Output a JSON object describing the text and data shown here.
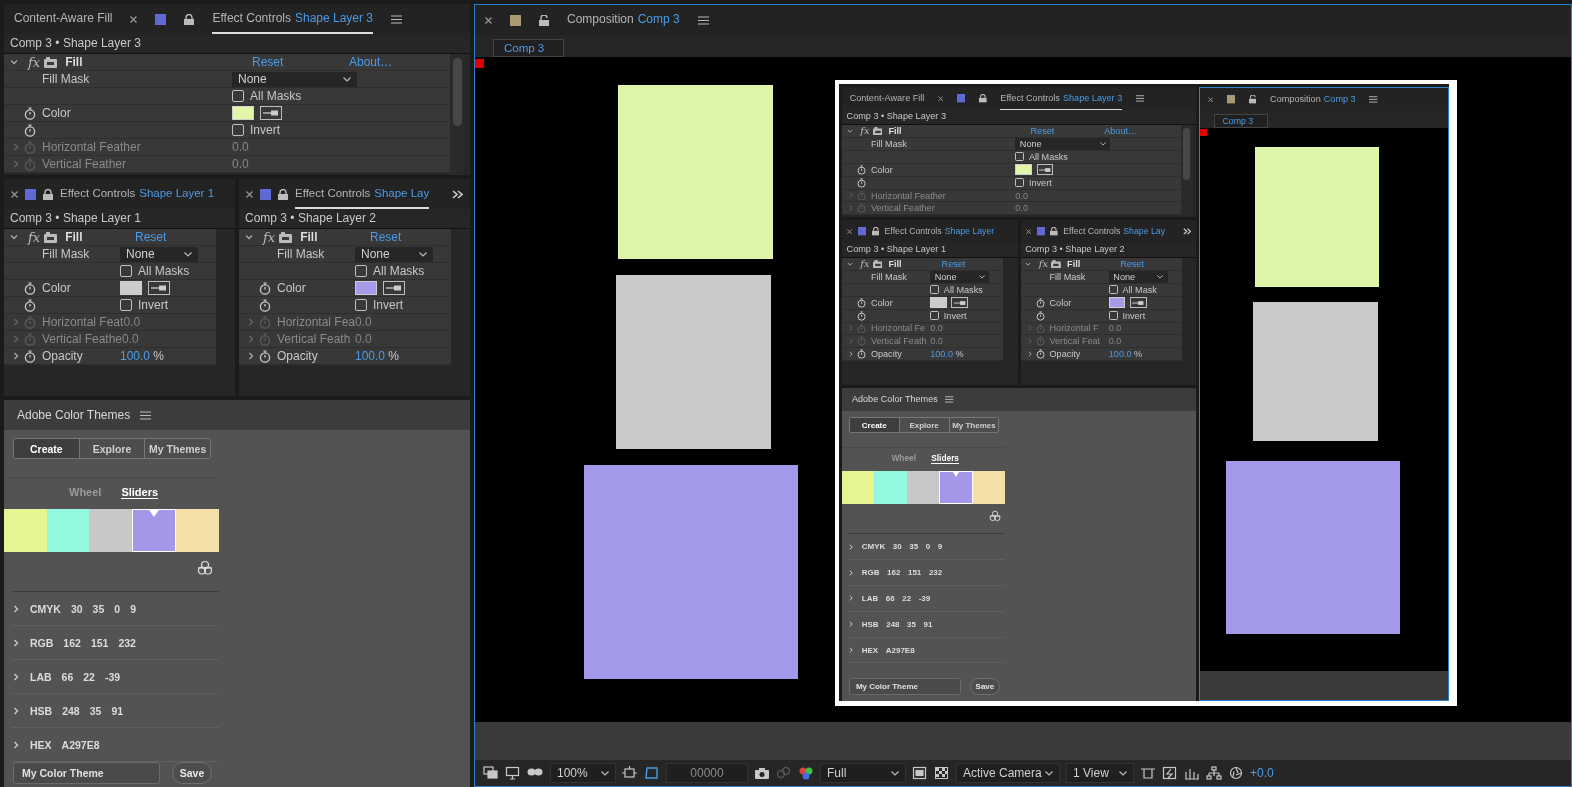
{
  "workspace": {
    "effect_panels": [
      {
        "tabs": [
          {
            "kind": "plain",
            "label": "Content-Aware Fill",
            "selected": false
          },
          {
            "kind": "effect",
            "label": "Effect Controls",
            "layer": "Shape Layer 3",
            "selected": true
          }
        ],
        "breadcrumb": "Comp 3 • Shape Layer 3",
        "effect": {
          "badge": "fx",
          "name": "Fill",
          "reset": "Reset",
          "about": "About…",
          "rows": [
            {
              "kind": "dropdown",
              "label": "Fill Mask",
              "value": "None",
              "stopwatch": false
            },
            {
              "kind": "checkbox",
              "label": "All Masks",
              "checked": false,
              "stopwatch": false
            },
            {
              "kind": "color",
              "label": "Color",
              "color": "#e1f6a6",
              "stopwatch": true
            },
            {
              "kind": "checkbox",
              "label": "Invert",
              "checked": false,
              "stopwatch": true
            },
            {
              "kind": "number",
              "label": "Horizontal Feather",
              "value": "0.0",
              "disabled": true,
              "stopwatch": true
            },
            {
              "kind": "number",
              "label": "Vertical Feather",
              "value": "0.0",
              "disabled": true,
              "stopwatch": true
            }
          ]
        }
      },
      {
        "tabs": [
          {
            "kind": "effect",
            "label": "Effect Controls",
            "layer": "Shape Layer 1",
            "selected": false
          }
        ],
        "breadcrumb": "Comp 3 • Shape Layer 1",
        "effect": {
          "badge": "fx",
          "name": "Fill",
          "reset": "Reset",
          "rows": [
            {
              "kind": "dropdown",
              "label": "Fill Mask",
              "value": "None",
              "stopwatch": false
            },
            {
              "kind": "checkbox",
              "label": "All Masks",
              "checked": false,
              "stopwatch": false
            },
            {
              "kind": "color",
              "label": "Color",
              "color": "#cbcbcb",
              "stopwatch": true
            },
            {
              "kind": "checkbox",
              "label": "Invert",
              "checked": false,
              "stopwatch": true
            },
            {
              "kind": "number",
              "label": "Horizontal Feat",
              "value": "0.0",
              "disabled": true,
              "stopwatch": true
            },
            {
              "kind": "number",
              "label": "Vertical Feathe",
              "value": "0.0",
              "disabled": true,
              "stopwatch": true
            },
            {
              "kind": "number",
              "label": "Opacity",
              "value": "100.0",
              "unit": "%",
              "disabled": false,
              "stopwatch": true
            }
          ]
        }
      },
      {
        "tabs": [
          {
            "kind": "effect",
            "label": "Effect Controls",
            "layer": "Shape Lay",
            "selected": true
          }
        ],
        "breadcrumb": "Comp 3 • Shape Layer 2",
        "effect": {
          "badge": "fx",
          "name": "Fill",
          "reset": "Reset",
          "rows": [
            {
              "kind": "dropdown",
              "label": "Fill Mask",
              "value": "None",
              "stopwatch": false
            },
            {
              "kind": "checkbox",
              "label": "All Masks",
              "checked": false,
              "stopwatch": false
            },
            {
              "kind": "color",
              "label": "Color",
              "color": "#a59bea",
              "stopwatch": true
            },
            {
              "kind": "checkbox",
              "label": "Invert",
              "checked": false,
              "stopwatch": true
            },
            {
              "kind": "number",
              "label": "Horizontal Fea",
              "value": "0.0",
              "disabled": true,
              "stopwatch": true
            },
            {
              "kind": "number",
              "label": "Vertical Feath",
              "value": "0.0",
              "disabled": true,
              "stopwatch": true
            },
            {
              "kind": "number",
              "label": "Opacity",
              "value": "100.0",
              "unit": "%",
              "disabled": false,
              "stopwatch": true
            }
          ]
        }
      }
    ],
    "color_themes": {
      "title": "Adobe Color Themes",
      "tabs": [
        {
          "label": "Create",
          "selected": true
        },
        {
          "label": "Explore",
          "selected": false
        },
        {
          "label": "My Themes",
          "selected": false
        }
      ],
      "modes": [
        {
          "label": "Wheel",
          "selected": false
        },
        {
          "label": "Sliders",
          "selected": true
        }
      ],
      "swatches": [
        {
          "color": "#e6f593",
          "selected": false
        },
        {
          "color": "#94f8e0",
          "selected": false
        },
        {
          "color": "#c8c8c8",
          "selected": false
        },
        {
          "color": "#a297e8",
          "selected": true
        },
        {
          "color": "#f5dfa8",
          "selected": false
        }
      ],
      "models": [
        {
          "name": "CMYK",
          "values": [
            "30",
            "35",
            "0",
            "9"
          ]
        },
        {
          "name": "RGB",
          "values": [
            "162",
            "151",
            "232"
          ]
        },
        {
          "name": "LAB",
          "values": [
            "66",
            "22",
            "-39"
          ]
        },
        {
          "name": "HSB",
          "values": [
            "248",
            "35",
            "91"
          ]
        },
        {
          "name": "HEX",
          "values": [
            "A297E8"
          ]
        }
      ],
      "theme_name": "My Color Theme",
      "save": "Save"
    },
    "composition": {
      "title": "Composition",
      "name": "Comp 3",
      "viewer_tabs": [
        {
          "label": "Comp 3",
          "selected": true
        }
      ],
      "viewer": {
        "layers": [
          {
            "kind": "shape",
            "color": "#ddf5a9"
          },
          {
            "kind": "shape",
            "color": "#c9c9c9"
          },
          {
            "kind": "shape",
            "color": "#a299e8"
          },
          {
            "kind": "screenshot",
            "workspace": {
              "effect_panels": [
                {
                  "tabs": [
                    {
                      "kind": "plain",
                      "label": "Content-Aware Fill",
                      "selected": false
                    },
                    {
                      "kind": "effect",
                      "label": "Effect Controls",
                      "layer": "Shape Layer 3",
                      "selected": true
                    }
                  ],
                  "breadcrumb": "Comp 3 • Shape Layer 3",
                  "effect": {
                    "badge": "fx",
                    "name": "Fill",
                    "reset": "Reset",
                    "about": "About…",
                    "rows": [
                      {
                        "kind": "dropdown",
                        "label": "Fill Mask",
                        "value": "None",
                        "stopwatch": false
                      },
                      {
                        "kind": "checkbox",
                        "label": "All Masks",
                        "checked": false,
                        "stopwatch": false
                      },
                      {
                        "kind": "color",
                        "label": "Color",
                        "color": "#e1f6a6",
                        "stopwatch": true
                      },
                      {
                        "kind": "checkbox",
                        "label": "Invert",
                        "checked": false,
                        "stopwatch": true
                      },
                      {
                        "kind": "number",
                        "label": "Horizontal Feather",
                        "value": "0.0",
                        "disabled": true,
                        "stopwatch": true
                      },
                      {
                        "kind": "number",
                        "label": "Vertical Feather",
                        "value": "0.0",
                        "disabled": true,
                        "stopwatch": true
                      }
                    ]
                  }
                },
                {
                  "tabs": [
                    {
                      "kind": "effect",
                      "label": "Effect Controls",
                      "layer": "Shape Layer",
                      "selected": false
                    }
                  ],
                  "breadcrumb": "Comp 3 • Shape Layer 1",
                  "effect": {
                    "badge": "fx",
                    "name": "Fill",
                    "reset": "Reset",
                    "rows": [
                      {
                        "kind": "dropdown",
                        "label": "Fill Mask",
                        "value": "None",
                        "stopwatch": false
                      },
                      {
                        "kind": "checkbox",
                        "label": "All Masks",
                        "checked": false,
                        "stopwatch": false
                      },
                      {
                        "kind": "color",
                        "label": "Color",
                        "color": "#cbcbcb",
                        "stopwatch": true
                      },
                      {
                        "kind": "checkbox",
                        "label": "Invert",
                        "checked": false,
                        "stopwatch": true
                      },
                      {
                        "kind": "number",
                        "label": "Horizontal Fe",
                        "value": "0.0",
                        "disabled": true,
                        "stopwatch": true
                      },
                      {
                        "kind": "number",
                        "label": "Vertical Feath",
                        "value": "0.0",
                        "disabled": true,
                        "stopwatch": true
                      },
                      {
                        "kind": "number",
                        "label": "Opacity",
                        "value": "100.0",
                        "unit": "%",
                        "disabled": false,
                        "stopwatch": true
                      }
                    ]
                  }
                },
                {
                  "tabs": [
                    {
                      "kind": "effect",
                      "label": "Effect Controls",
                      "layer": "Shape Lay",
                      "selected": false
                    }
                  ],
                  "breadcrumb": "Comp 3 • Shape Layer 2",
                  "effect": {
                    "badge": "fx",
                    "name": "Fill",
                    "reset": "Reset",
                    "rows": [
                      {
                        "kind": "dropdown",
                        "label": "Fill Mask",
                        "value": "None",
                        "stopwatch": false
                      },
                      {
                        "kind": "checkbox",
                        "label": "All Mask",
                        "checked": false,
                        "stopwatch": false
                      },
                      {
                        "kind": "color",
                        "label": "Color",
                        "color": "#a59bea",
                        "stopwatch": true
                      },
                      {
                        "kind": "checkbox",
                        "label": "Invert",
                        "checked": false,
                        "stopwatch": true
                      },
                      {
                        "kind": "number",
                        "label": "Horizontal F",
                        "value": "0.0",
                        "disabled": true,
                        "stopwatch": true
                      },
                      {
                        "kind": "number",
                        "label": "Vertical Feat",
                        "value": "0.0",
                        "disabled": true,
                        "stopwatch": true
                      },
                      {
                        "kind": "number",
                        "label": "Opacity",
                        "value": "100.0",
                        "unit": "%",
                        "disabled": false,
                        "stopwatch": true
                      }
                    ]
                  }
                }
              ],
              "color_themes": {
                "title": "Adobe Color Themes",
                "tabs": [
                  {
                    "label": "Create",
                    "selected": true
                  },
                  {
                    "label": "Explore",
                    "selected": false
                  },
                  {
                    "label": "My Themes",
                    "selected": false
                  }
                ],
                "modes": [
                  {
                    "label": "Wheel",
                    "selected": false
                  },
                  {
                    "label": "Sliders",
                    "selected": true
                  }
                ],
                "swatches": [
                  {
                    "color": "#e6f593",
                    "selected": false
                  },
                  {
                    "color": "#94f8e0",
                    "selected": false
                  },
                  {
                    "color": "#c8c8c8",
                    "selected": false
                  },
                  {
                    "color": "#a297e8",
                    "selected": true
                  },
                  {
                    "color": "#f5dfa8",
                    "selected": false
                  }
                ],
                "models": [
                  {
                    "name": "CMYK",
                    "values": [
                      "30",
                      "35",
                      "0",
                      "9"
                    ]
                  },
                  {
                    "name": "RGB",
                    "values": [
                      "162",
                      "151",
                      "232"
                    ]
                  },
                  {
                    "name": "LAB",
                    "values": [
                      "66",
                      "22",
                      "-39"
                    ]
                  },
                  {
                    "name": "HSB",
                    "values": [
                      "248",
                      "35",
                      "91"
                    ]
                  },
                  {
                    "name": "HEX",
                    "values": [
                      "A297E8"
                    ]
                  }
                ],
                "theme_name": "My Color Theme",
                "save": "Save"
              },
              "composition": {
                "title": "Composition",
                "name": "Comp 3",
                "viewer_tabs": [
                  {
                    "label": "Comp 3",
                    "selected": true
                  }
                ],
                "viewer": {
                  "layers": [
                    {
                      "kind": "shape",
                      "color": "#ddf5a9"
                    },
                    {
                      "kind": "shape",
                      "color": "#c9c9c9"
                    },
                    {
                      "kind": "shape",
                      "color": "#a299e8"
                    }
                  ]
                }
              }
            }
          }
        ]
      },
      "toolbar": {
        "magnification": "100%",
        "timecode": "00000",
        "resolution": "Full",
        "camera": "Active Camera",
        "view_layout": "1 View",
        "exposure": "+0.0"
      }
    }
  }
}
